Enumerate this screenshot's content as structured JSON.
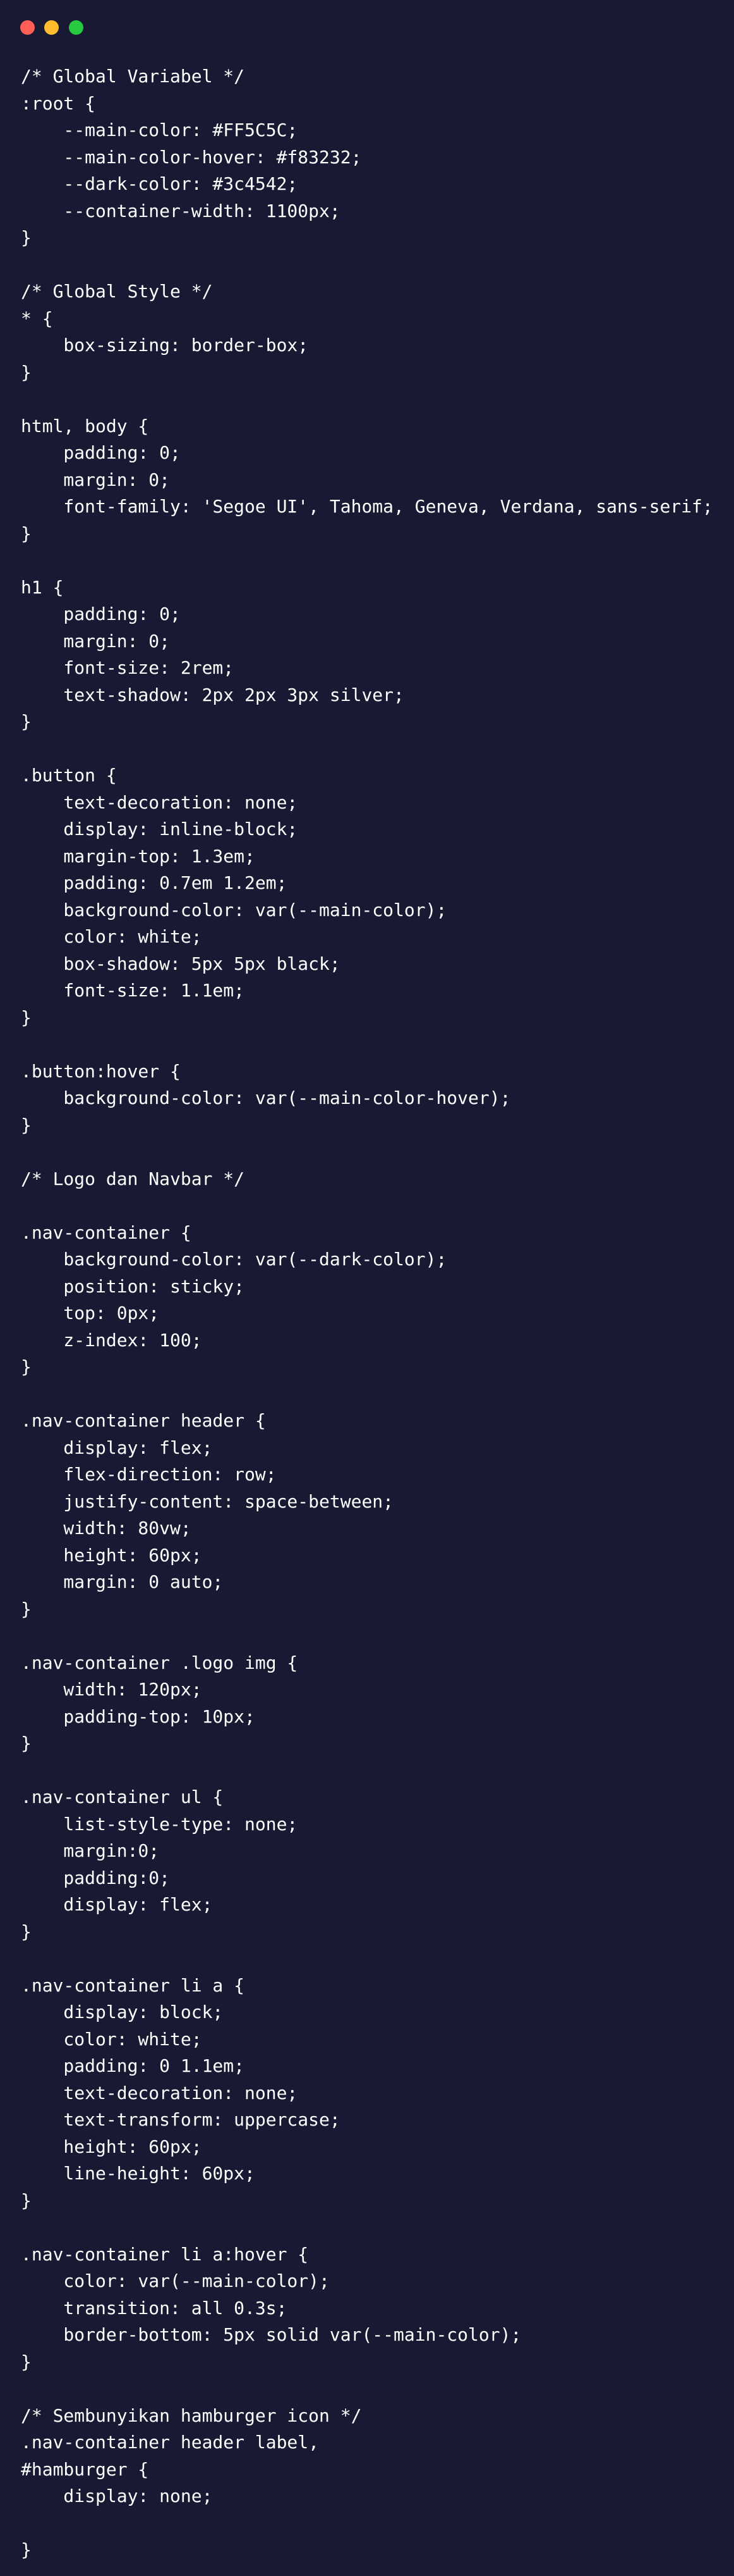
{
  "window": {
    "controls": [
      {
        "name": "close",
        "color": "#ff5f56"
      },
      {
        "name": "minimize",
        "color": "#ffbd2e"
      },
      {
        "name": "maximize",
        "color": "#27c93f"
      }
    ]
  },
  "colors": {
    "background": "#181a33",
    "text": "#ffffff"
  },
  "code_lines": [
    "/* Global Variabel */",
    ":root {",
    "    --main-color: #FF5C5C;",
    "    --main-color-hover: #f83232;",
    "    --dark-color: #3c4542;",
    "    --container-width: 1100px;",
    "}",
    "",
    "/* Global Style */",
    "* {",
    "    box-sizing: border-box;",
    "}",
    "",
    "html, body {",
    "    padding: 0;",
    "    margin: 0;",
    "    font-family: 'Segoe UI', Tahoma, Geneva, Verdana, sans-serif;",
    "}",
    "",
    "h1 {",
    "    padding: 0;",
    "    margin: 0;",
    "    font-size: 2rem;",
    "    text-shadow: 2px 2px 3px silver;",
    "}",
    "",
    ".button {",
    "    text-decoration: none;",
    "    display: inline-block;",
    "    margin-top: 1.3em;",
    "    padding: 0.7em 1.2em;",
    "    background-color: var(--main-color);",
    "    color: white;",
    "    box-shadow: 5px 5px black;",
    "    font-size: 1.1em;",
    "}",
    "",
    ".button:hover {",
    "    background-color: var(--main-color-hover);",
    "}",
    "",
    "/* Logo dan Navbar */",
    "",
    ".nav-container {",
    "    background-color: var(--dark-color);",
    "    position: sticky;",
    "    top: 0px;",
    "    z-index: 100;",
    "}",
    "",
    ".nav-container header {",
    "    display: flex;",
    "    flex-direction: row;",
    "    justify-content: space-between;",
    "    width: 80vw;",
    "    height: 60px;",
    "    margin: 0 auto;",
    "}",
    "",
    ".nav-container .logo img {",
    "    width: 120px;",
    "    padding-top: 10px;",
    "}",
    "",
    ".nav-container ul {",
    "    list-style-type: none;",
    "    margin:0;",
    "    padding:0;",
    "    display: flex;",
    "}",
    "",
    ".nav-container li a {",
    "    display: block;",
    "    color: white;",
    "    padding: 0 1.1em;",
    "    text-decoration: none;",
    "    text-transform: uppercase;",
    "    height: 60px;",
    "    line-height: 60px;",
    "}",
    "",
    ".nav-container li a:hover {",
    "    color: var(--main-color);",
    "    transition: all 0.3s;",
    "    border-bottom: 5px solid var(--main-color);",
    "}",
    "",
    "/* Sembunyikan hamburger icon */",
    ".nav-container header label,",
    "#hamburger {",
    "    display: none;",
    "",
    "}"
  ]
}
